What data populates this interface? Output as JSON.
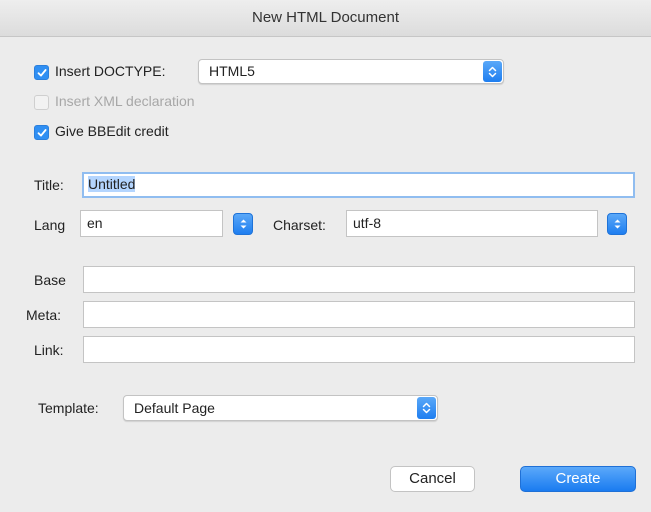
{
  "window": {
    "title": "New HTML Document"
  },
  "options": {
    "doctype": {
      "label": "Insert DOCTYPE:",
      "checked": true,
      "value": "HTML5"
    },
    "xml_decl": {
      "label": "Insert XML declaration",
      "checked": false,
      "enabled": false
    },
    "credit": {
      "label": "Give BBEdit credit",
      "checked": true
    }
  },
  "fields": {
    "title": {
      "label": "Title:",
      "value": "Untitled"
    },
    "lang": {
      "label": "Lang",
      "value": "en"
    },
    "charset": {
      "label": "Charset:",
      "value": "utf-8"
    },
    "base": {
      "label": "Base",
      "value": ""
    },
    "meta": {
      "label": "Meta:",
      "value": ""
    },
    "link": {
      "label": "Link:",
      "value": ""
    }
  },
  "template": {
    "label": "Template:",
    "value": "Default Page"
  },
  "buttons": {
    "cancel": "Cancel",
    "create": "Create"
  },
  "colors": {
    "accent": "#2f8ff3",
    "selection": "#b4d5fe",
    "focus_ring": "#90bdf0"
  }
}
